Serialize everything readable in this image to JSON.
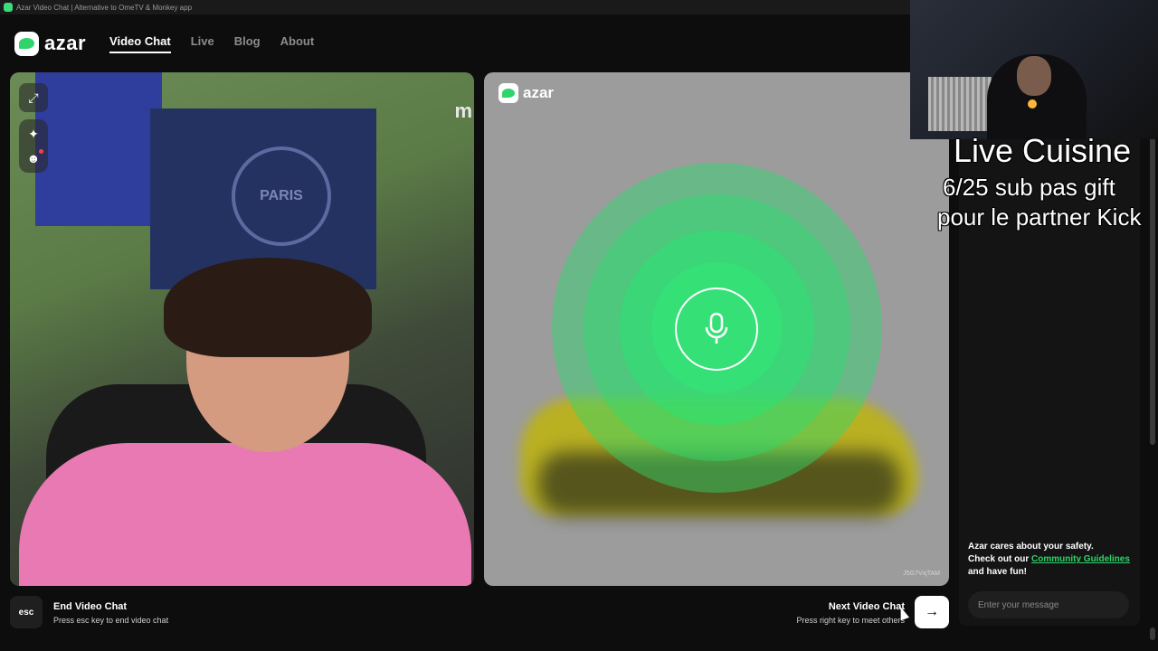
{
  "browser": {
    "tab_title": "Azar Video Chat | Alternative to OmeTV & Monkey app"
  },
  "header": {
    "logo_text": "azar",
    "nav": [
      {
        "label": "Video Chat",
        "active": true
      },
      {
        "label": "Live",
        "active": false
      },
      {
        "label": "Blog",
        "active": false
      },
      {
        "label": "About",
        "active": false
      }
    ]
  },
  "left_video": {
    "poster_text": "PARIS",
    "edge_letter": "m",
    "tools": {
      "expand_icon": "expand-icon",
      "sparkle_icon": "sparkle-icon",
      "face_icon": "face-filter-icon"
    }
  },
  "right_video": {
    "logo_text": "azar",
    "watermark": "J5G7VxjTAM",
    "center_icon": "microphone-icon",
    "accent_color": "#2fd46b"
  },
  "chat": {
    "safety_line1": "Azar cares about your safety.",
    "safety_line2_prefix": "Check out our ",
    "safety_link": "Community Guidelines",
    "safety_line2_suffix": " and have fun!",
    "input_placeholder": "Enter your message"
  },
  "bottom": {
    "esc_label": "esc",
    "end_title": "End Video Chat",
    "end_sub": "Press esc key to end video chat",
    "next_title": "Next Video Chat",
    "next_sub": "Press right key to meet others",
    "next_icon": "arrow-right-icon"
  },
  "stream_overlay": {
    "title": "Live Cuisine",
    "line1": "6/25 sub pas gift",
    "line2": "pour le partner Kick"
  }
}
